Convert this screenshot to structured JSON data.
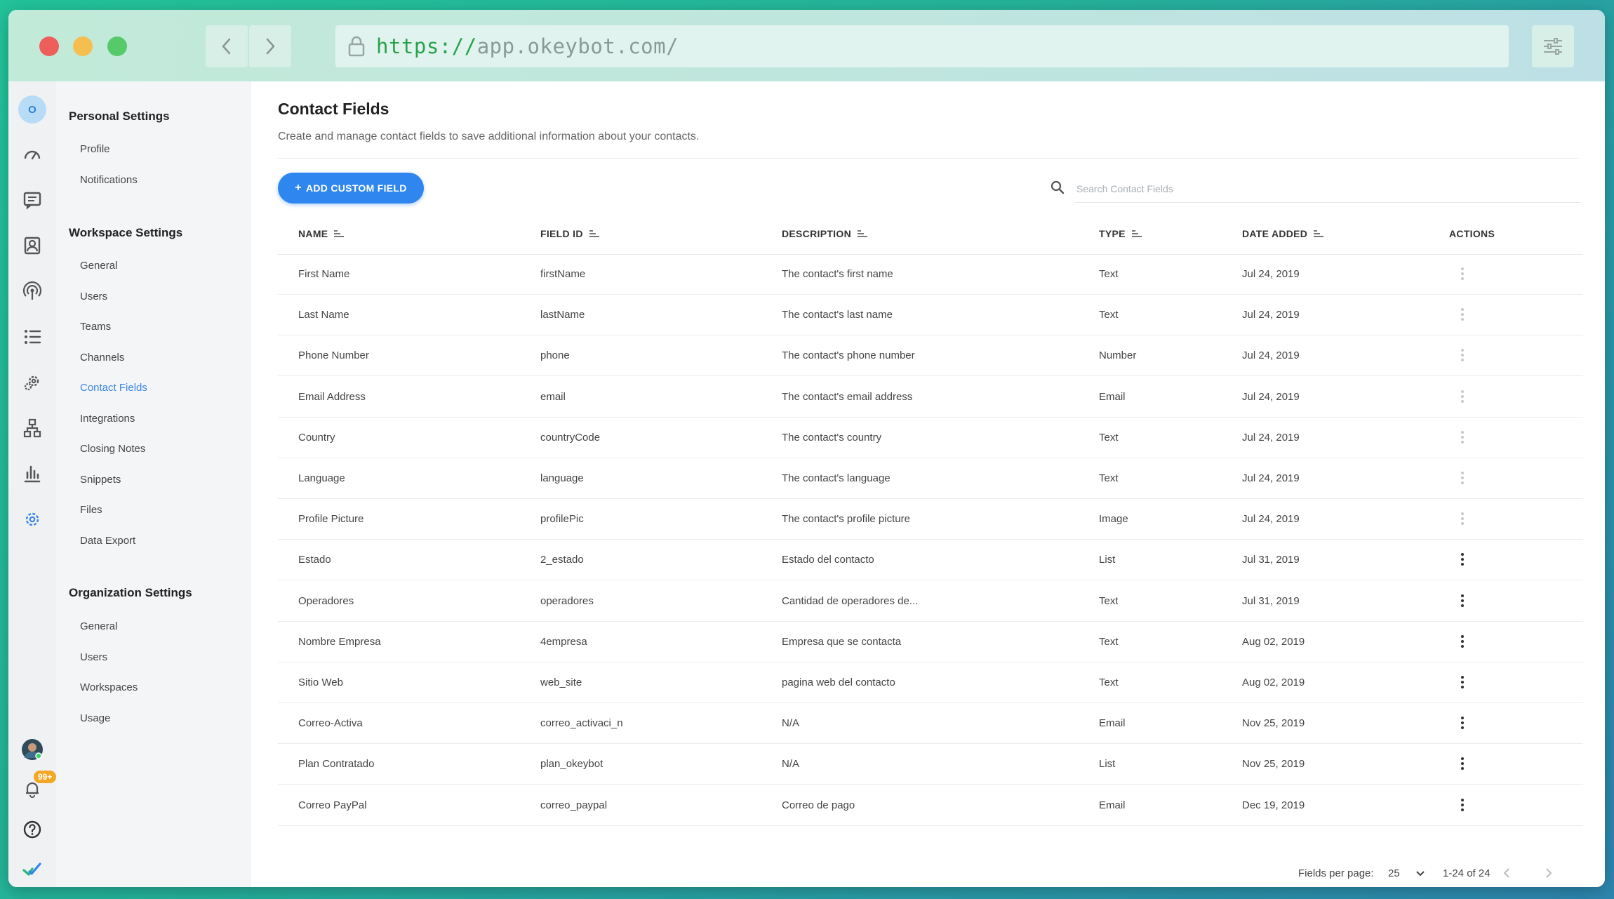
{
  "browser": {
    "url_scheme": "https://",
    "url_host": "app.okeybot.com/"
  },
  "rail": {
    "avatar_letter": "O",
    "notification_badge": "99+",
    "icons": [
      "dashboard-icon",
      "chat-icon",
      "contacts-icon",
      "broadcast-icon",
      "list-icon",
      "automation-icon",
      "hierarchy-icon",
      "analytics-icon",
      "settings-icon"
    ]
  },
  "settings_nav": {
    "personal_heading": "Personal Settings",
    "personal_items": [
      "Profile",
      "Notifications"
    ],
    "workspace_heading": "Workspace Settings",
    "workspace_items": [
      "General",
      "Users",
      "Teams",
      "Channels",
      "Contact Fields",
      "Integrations",
      "Closing Notes",
      "Snippets",
      "Files",
      "Data Export"
    ],
    "organization_heading": "Organization Settings",
    "organization_items": [
      "General",
      "Users",
      "Workspaces",
      "Usage"
    ],
    "active_item": "Contact Fields"
  },
  "main": {
    "title": "Contact Fields",
    "subtitle": "Create and manage contact fields to save additional information about your contacts.",
    "add_button": "ADD CUSTOM FIELD",
    "search_placeholder": "Search Contact Fields"
  },
  "table": {
    "columns": {
      "name": "NAME",
      "field_id": "FIELD ID",
      "description": "DESCRIPTION",
      "type": "TYPE",
      "date_added": "DATE ADDED",
      "actions": "ACTIONS"
    },
    "rows": [
      {
        "name": "First Name",
        "field_id": "firstName",
        "description": "The contact's first name",
        "type": "Text",
        "date": "Jul 24, 2019",
        "actions_enabled": false
      },
      {
        "name": "Last Name",
        "field_id": "lastName",
        "description": "The contact's last name",
        "type": "Text",
        "date": "Jul 24, 2019",
        "actions_enabled": false
      },
      {
        "name": "Phone Number",
        "field_id": "phone",
        "description": "The contact's phone number",
        "type": "Number",
        "date": "Jul 24, 2019",
        "actions_enabled": false
      },
      {
        "name": "Email Address",
        "field_id": "email",
        "description": "The contact's email address",
        "type": "Email",
        "date": "Jul 24, 2019",
        "actions_enabled": false
      },
      {
        "name": "Country",
        "field_id": "countryCode",
        "description": "The contact's country",
        "type": "Text",
        "date": "Jul 24, 2019",
        "actions_enabled": false
      },
      {
        "name": "Language",
        "field_id": "language",
        "description": "The contact's language",
        "type": "Text",
        "date": "Jul 24, 2019",
        "actions_enabled": false
      },
      {
        "name": "Profile Picture",
        "field_id": "profilePic",
        "description": "The contact's profile picture",
        "type": "Image",
        "date": "Jul 24, 2019",
        "actions_enabled": false
      },
      {
        "name": "Estado",
        "field_id": "2_estado",
        "description": "Estado del contacto",
        "type": "List",
        "date": "Jul 31, 2019",
        "actions_enabled": true
      },
      {
        "name": "Operadores",
        "field_id": "operadores",
        "description": "Cantidad de operadores de...",
        "type": "Text",
        "date": "Jul 31, 2019",
        "actions_enabled": true
      },
      {
        "name": "Nombre Empresa",
        "field_id": "4empresa",
        "description": "Empresa que se contacta",
        "type": "Text",
        "date": "Aug 02, 2019",
        "actions_enabled": true
      },
      {
        "name": "Sitio Web",
        "field_id": "web_site",
        "description": "pagina web del contacto",
        "type": "Text",
        "date": "Aug 02, 2019",
        "actions_enabled": true
      },
      {
        "name": "Correo-Activa",
        "field_id": "correo_activaci_n",
        "description": "N/A",
        "type": "Email",
        "date": "Nov 25, 2019",
        "actions_enabled": true
      },
      {
        "name": "Plan Contratado",
        "field_id": "plan_okeybot",
        "description": "N/A",
        "type": "List",
        "date": "Nov 25, 2019",
        "actions_enabled": true
      },
      {
        "name": "Correo PayPal",
        "field_id": "correo_paypal",
        "description": "Correo de pago",
        "type": "Email",
        "date": "Dec 19, 2019",
        "actions_enabled": true
      }
    ]
  },
  "footer": {
    "per_page_label": "Fields per page:",
    "per_page_value": "25",
    "range": "1-24 of 24"
  },
  "colors": {
    "accent": "#2f86ee",
    "active_nav": "#3a86e6",
    "badge": "#f5a623"
  }
}
